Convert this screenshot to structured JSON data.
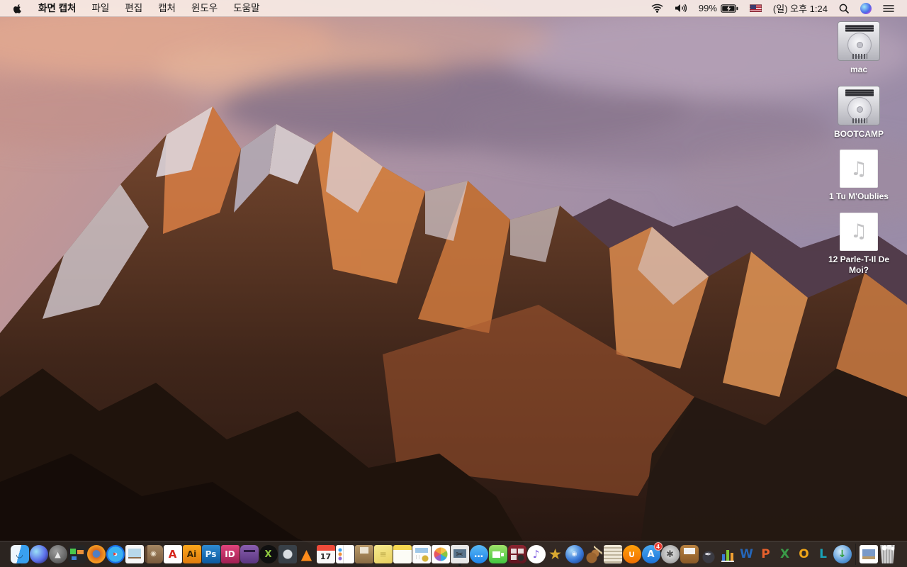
{
  "menu_bar": {
    "apple_menu_icon": "apple-logo",
    "menus": [
      "화면 캡처",
      "파일",
      "편집",
      "캡처",
      "윈도우",
      "도움말"
    ],
    "status_right": {
      "wifi_icon": "wifi-icon",
      "volume_icon": "volume-icon",
      "battery_percent": "99%",
      "battery_icon": "battery-charging-icon",
      "input_source": "US",
      "clock": "(일) 오후 1:24",
      "spotlight_icon": "spotlight-search-icon",
      "siri_icon": "siri-icon",
      "notification_center_icon": "notification-center-icon"
    }
  },
  "desktop": {
    "icons": [
      {
        "label": "mac",
        "type": "hard-drive"
      },
      {
        "label": "BOOTCAMP",
        "type": "hard-drive"
      },
      {
        "label": "1 Tu M'Oublies",
        "type": "audio-file",
        "glyph": "♫"
      },
      {
        "label": "12 Parle-T-Il De Moi?",
        "type": "audio-file",
        "glyph": "♫"
      }
    ]
  },
  "dock": {
    "items": [
      {
        "name": "finder",
        "shape": "rounded",
        "bgColor": "#39a0ef",
        "bg": "linear-gradient(105deg,#eef6fd 0 46%,#39a0ef 46%)",
        "glyph": "◡",
        "color": "#1b4e77",
        "size": 12,
        "running": true
      },
      {
        "name": "siri",
        "shape": "circle",
        "bgColor": "#3a3a8c",
        "bg": "radial-gradient(circle at 35% 35%,#9ae0f7,#5b6ee8 55%,#1c1650)",
        "glyph": "",
        "color": "#fff",
        "size": 10
      },
      {
        "name": "launchpad",
        "shape": "circle",
        "bgColor": "#5d5d5d",
        "bg": "radial-gradient(circle at 40% 35%,#9e9e9e,#5d5d5d 70%,#3f3f3f)",
        "glyph": "▲",
        "color": "#e8e8e8",
        "size": 11
      },
      {
        "name": "mission-control",
        "shape": "rounded",
        "bgColor": "#262626",
        "bg": "linear-gradient(#49c84c,#49c84c) 3px 5px/8px 8px no-repeat,linear-gradient(#e8913a,#e8913a) 13px 7px/9px 6px no-repeat,linear-gradient(#3f83d6,#3f83d6) 5px 16px/7px 5px no-repeat,#262626",
        "glyph": "",
        "color": "#fff",
        "size": 10
      },
      {
        "name": "firefox",
        "shape": "circle",
        "bgColor": "#e5731a",
        "bg": "radial-gradient(circle at 50% 48%,#4f7ec2 0 27%,#d96b1e 30%,#f59b21 65%,#e5731a)",
        "glyph": "",
        "color": "#fff",
        "size": 10
      },
      {
        "name": "safari",
        "shape": "circle",
        "bgColor": "#1b72e8",
        "bg": "radial-gradient(circle at 50% 50%,#e8f4fb 0 12%,#3bb2f2 13% 58%,#1b72e8 59% 86%,#dfe3e8 87%)",
        "glyph": "▸",
        "color": "#e8352c",
        "size": 9
      },
      {
        "name": "preview",
        "shape": "rounded-sm",
        "bgColor": "#f7f7f7",
        "bg": "linear-gradient(#b8d8ea,#b8d8ea) 4px 5px/18px 12px no-repeat,linear-gradient(#8a6a4a,#8a6a4a) 4px 15px/18px 4px no-repeat,#f7f7f7",
        "glyph": "",
        "color": "#333",
        "size": 9
      },
      {
        "name": "contacts",
        "shape": "rounded",
        "bgColor": "#8a6c4c",
        "bg": "linear-gradient(90deg,#5f4530 0 4px,transparent 0),linear-gradient(#a48662,#7b5c3e)",
        "glyph": "◉",
        "color": "#e9ddc8",
        "size": 10
      },
      {
        "name": "acrobat-reader",
        "shape": "rounded-sm",
        "bgColor": "#ffffff",
        "bg": "#ffffff",
        "glyph": "A",
        "color": "#d6281e",
        "size": 15,
        "weight": "bold"
      },
      {
        "name": "adobe-illustrator",
        "shape": "rounded-sm",
        "bgColor": "#e8930c",
        "bg": "linear-gradient(#fba61c,#e07c0e)",
        "glyph": "Ai",
        "color": "#3a2604",
        "size": 12,
        "weight": "bold"
      },
      {
        "name": "adobe-photoshop",
        "shape": "rounded-sm",
        "bgColor": "#0c5a9e",
        "bg": "linear-gradient(#2f8ad1,#0c5a9e)",
        "glyph": "Ps",
        "color": "#eaf6ff",
        "size": 12,
        "weight": "bold"
      },
      {
        "name": "adobe-indesign",
        "shape": "rounded-sm",
        "bgColor": "#a01f52",
        "bg": "linear-gradient(#e0447c,#a01f52)",
        "glyph": "ID",
        "color": "#ffffff",
        "size": 12,
        "weight": "bold"
      },
      {
        "name": "toast-titanium",
        "shape": "rounded",
        "bgColor": "#5a3580",
        "bg": "linear-gradient(#2a1840,#2a1840) 5px 7px/16px 3px no-repeat,linear-gradient(#8a5fb0,#5a3580)",
        "glyph": "",
        "color": "#d8c8e8",
        "size": 11
      },
      {
        "name": "xld",
        "shape": "circle",
        "bgColor": "#101010",
        "bg": "#101010",
        "glyph": "X",
        "color": "#8cc63f",
        "size": 13,
        "weight": "bold"
      },
      {
        "name": "disc-ripper",
        "shape": "rounded-sm",
        "bgColor": "#30363c",
        "bg": "radial-gradient(circle 7px at 13px 13px,#d8dde2 6px,#384048 7px)",
        "glyph": "",
        "color": "#fff",
        "size": 10
      },
      {
        "name": "vlc",
        "shape": "rounded-sm",
        "bgColor": "",
        "bg": "",
        "glyph": "▲",
        "color": "#ff8c1a",
        "size": 20
      },
      {
        "name": "calendar",
        "shape": "rounded-sm",
        "bgColor": "#f8f8f8",
        "bg": "linear-gradient(#ef4b3a,#ef4b3a) 0 0/100% 8px no-repeat,#f8f8f8",
        "glyph": "17",
        "color": "#2b2b2b",
        "size": 11,
        "weight": "bold",
        "pad_top": 6
      },
      {
        "name": "reminders",
        "shape": "rounded-sm",
        "bgColor": "#ffffff",
        "bg": "radial-gradient(circle 2px at 6px 7px,#3aa0f0 2px,transparent 3px),radial-gradient(circle 2px at 6px 13px,#ef8f3a 2px,transparent 3px),radial-gradient(circle 2px at 6px 19px,#8f68d6 2px,transparent 3px),linear-gradient(90deg,transparent 0 10px,#dcdcdc 10px 11px,transparent 11px),#ffffff",
        "glyph": "",
        "color": "#333",
        "size": 9
      },
      {
        "name": "archive-box",
        "shape": "rounded-sm",
        "bgColor": "#a3865c",
        "bg": "linear-gradient(#ece4d4,#ece4d4) 7px 3px/12px 9px no-repeat,linear-gradient(#b99a6b,#8a6c44)",
        "glyph": "",
        "color": "#fff",
        "size": 9
      },
      {
        "name": "stickies",
        "shape": "rounded-sm",
        "bgColor": "#f0dd75",
        "bg": "linear-gradient(160deg,#f7ea8f,#e8d060)",
        "glyph": "≡",
        "color": "#b8a545",
        "size": 12
      },
      {
        "name": "notes",
        "shape": "rounded-sm",
        "bgColor": "#fcfcf6",
        "bg": "linear-gradient(#f7d851,#f7d851) 0 0/100% 7px no-repeat,#fcfcf6",
        "glyph": "",
        "color": "#999",
        "size": 9
      },
      {
        "name": "document-app",
        "shape": "rounded-sm",
        "bgColor": "#fbfbfb",
        "bg": "linear-gradient(#9ec7e8,#9ec7e8) 4px 4px/18px 7px no-repeat,radial-gradient(circle 4px at 18px 19px,#d4b23a 4px,transparent 5px),linear-gradient(90deg,transparent 0 5px,#d8d8d8 5px 6px,transparent 6px 9px,#d8d8d8 9px 10px,transparent 10px) 0 14px/26px 6px no-repeat,#fbfbfb",
        "glyph": "",
        "color": "#777",
        "size": 9
      },
      {
        "name": "photos",
        "shape": "rounded-sm",
        "bgColor": "#ffffff",
        "bg": "radial-gradient(circle 11px at 13px 13px,transparent 9px,#fff 10px),conic-gradient(#f6c24a 0 60deg,#8bc541 0 120deg,#35a8e0 0 180deg,#9a5fc9 0 240deg,#e8565f 0 300deg,#f29a3a 0 360deg)",
        "glyph": "",
        "color": "#fff",
        "size": 10
      },
      {
        "name": "grab-screen-capture",
        "shape": "rounded-sm",
        "bgColor": "#e8e8e8",
        "bg": "linear-gradient(#5a748c,#5a748c) 4px 6px/18px 12px no-repeat,#e8e8e8",
        "glyph": "✂",
        "color": "#2b2b2b",
        "size": 12,
        "running": true
      },
      {
        "name": "messages",
        "shape": "circle",
        "bgColor": "#1d82e8",
        "bg": "linear-gradient(#59b9f5,#1d82e8)",
        "glyph": "…",
        "color": "#ffffff",
        "size": 13,
        "weight": "bold"
      },
      {
        "name": "facetime",
        "shape": "rounded",
        "bgColor": "#3fc83f",
        "bg": "linear-gradient(#ffffff,#ffffff) 5px 9px/11px 9px no-repeat,linear-gradient(#ffffff,#ffffff) 17px 11px/4px 5px no-repeat,linear-gradient(#9fe26a,#3fc83f)",
        "glyph": "",
        "color": "#fff",
        "size": 10
      },
      {
        "name": "photo-booth",
        "shape": "rounded",
        "bgColor": "#6b1c28",
        "bg": "linear-gradient(#e8dede,#e8dede) 4px 5px/8px 7px no-repeat,linear-gradient(#e8dede,#e8dede) 14px 5px/8px 7px no-repeat,linear-gradient(#e8dede,#e8dede) 4px 14px/8px 7px no-repeat,radial-gradient(circle 4px at 18px 18px,#2b2b2b 4px,transparent 5px),linear-gradient(#8a2430,#5f1620)",
        "glyph": "",
        "color": "#fff",
        "size": 9
      },
      {
        "name": "itunes",
        "shape": "circle",
        "bgColor": "#ffffff",
        "bg": "#ffffff",
        "glyph": "♪",
        "color": "#7b5ae0",
        "size": 15,
        "weight": "bold"
      },
      {
        "name": "imovie",
        "shape": "rounded-sm",
        "bgColor": "",
        "bg": "",
        "glyph": "★",
        "color": "#d8a730",
        "size": 21
      },
      {
        "name": "idvd",
        "shape": "circle",
        "bgColor": "#2a5ab0",
        "bg": "radial-gradient(circle at 35% 30%,#a8d8f8,#3a7ad8 55%,#16337a)",
        "glyph": "◉",
        "color": "rgba(255,255,255,.85)",
        "size": 9
      },
      {
        "name": "garageband",
        "shape": "rounded-sm",
        "bgColor": "",
        "bg": "radial-gradient(circle 7px at 10px 18px,#9a6430 7px,transparent 8px),radial-gradient(circle 5px at 15px 12px,#af763c 5px,transparent 6px),linear-gradient(40deg,transparent 0 45%,#d8c49a 45% 58%,transparent 58%) 13px 1px/12px 13px no-repeat",
        "glyph": "",
        "color": "#fff",
        "size": 9
      },
      {
        "name": "newspapers",
        "shape": "rounded-sm",
        "bgColor": "#cfc5b0",
        "bg": "repeating-linear-gradient(#efe8d8 0 3px,#bfb49c 3px 5px)",
        "glyph": "",
        "color": "#6b5f49",
        "size": 9
      },
      {
        "name": "ibooks",
        "shape": "circle",
        "bgColor": "#f8860a",
        "bg": "linear-gradient(#ff9f0a,#f07000)",
        "glyph": "∪",
        "color": "#ffffff",
        "size": 13,
        "weight": "bold"
      },
      {
        "name": "app-store",
        "shape": "circle",
        "bgColor": "#1b72d8",
        "bg": "linear-gradient(#4aa9ef,#1b72d8)",
        "glyph": "A",
        "color": "#ffffff",
        "size": 13,
        "weight": "bold",
        "badge": "4"
      },
      {
        "name": "system-preferences",
        "shape": "circle",
        "bgColor": "#a8a8a8",
        "bg": "radial-gradient(circle at 50% 45%,#e8e8e8,#a8a8a8 70%,#7a7a7a)",
        "glyph": "✱",
        "color": "#555555",
        "size": 13
      },
      {
        "name": "keynote",
        "shape": "rounded",
        "bgColor": "#9a6a30",
        "bg": "linear-gradient(#f2f2f2,#f2f2f2) 5px 4px/16px 9px no-repeat,linear-gradient(#b8813f,#8a5a28)",
        "glyph": "",
        "color": "#fff",
        "size": 9
      },
      {
        "name": "pages-iwork",
        "shape": "rounded-sm",
        "bgColor": "",
        "bg": "radial-gradient(circle 8px at 13px 17px,#3a3a42 8px,transparent 9px)",
        "glyph": "✒",
        "color": "#d8d8e0",
        "size": 12
      },
      {
        "name": "numbers-iwork",
        "shape": "rounded-sm",
        "bgColor": "",
        "bg": "linear-gradient(#3a7ad8,#3a7ad8) 5px 13px/4px 9px no-repeat,linear-gradient(#7ec832,#7ec832) 11px 7px/4px 15px no-repeat,linear-gradient(#f0a032,#f0a032) 17px 11px/4px 11px no-repeat,linear-gradient(#e8e8e8,#e8e8e8) 4px 22px/18px 2px no-repeat",
        "glyph": "",
        "color": "#fff",
        "size": 9
      },
      {
        "name": "microsoft-word",
        "shape": "rounded-sm",
        "bgColor": "",
        "bg": "",
        "glyph": "W",
        "color": "#2566b8",
        "size": 17,
        "weight": "bold"
      },
      {
        "name": "microsoft-powerpoint",
        "shape": "rounded-sm",
        "bgColor": "",
        "bg": "",
        "glyph": "P",
        "color": "#e8612c",
        "size": 17,
        "weight": "bold"
      },
      {
        "name": "microsoft-excel",
        "shape": "rounded-sm",
        "bgColor": "",
        "bg": "",
        "glyph": "X",
        "color": "#3a9a48",
        "size": 17,
        "weight": "bold"
      },
      {
        "name": "microsoft-outlook",
        "shape": "rounded-sm",
        "bgColor": "",
        "bg": "",
        "glyph": "O",
        "color": "#f0a518",
        "size": 17,
        "weight": "bold"
      },
      {
        "name": "microsoft-lync",
        "shape": "rounded-sm",
        "bgColor": "",
        "bg": "",
        "glyph": "L",
        "color": "#18a3b8",
        "size": 17,
        "weight": "bold"
      },
      {
        "name": "download-manager",
        "shape": "circle",
        "bgColor": "#4a8ac8",
        "bg": "radial-gradient(circle at 40% 35%,#d8eefb,#5a9ad8 60%,#2a6ab0)",
        "glyph": "↓",
        "color": "#2e9e3a",
        "size": 14,
        "weight": "bold"
      },
      {
        "type": "separator"
      },
      {
        "name": "document-file",
        "shape": "rounded-sm",
        "bgColor": "#ffffff",
        "bg": "linear-gradient(#7a9ac8,#7a9ac8) 4px 6px/18px 10px no-repeat,linear-gradient(#b89a6a,#b89a6a) 4px 16px/18px 4px no-repeat,#ffffff",
        "glyph": "",
        "color": "#777",
        "size": 9
      },
      {
        "name": "trash-full",
        "shape": "trash",
        "bgColor": "#b8b8b8",
        "bg": "radial-gradient(circle 3px at 8px 4px,#ffffff 3px,transparent 4px),radial-gradient(circle 3px at 15px 3px,#f0f0f0 3px,transparent 4px),radial-gradient(circle 2px at 20px 5px,#ffffff 2px,transparent 3px),repeating-linear-gradient(90deg,#d2d2d2 0 2px,#a5a5a5 2px 4px)",
        "glyph": "",
        "color": "#fff",
        "size": 9
      }
    ]
  }
}
